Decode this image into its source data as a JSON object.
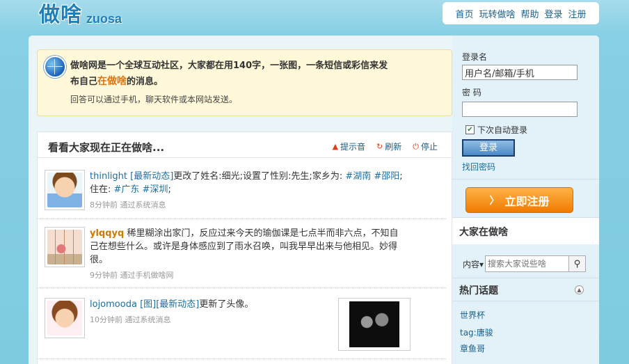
{
  "header": {
    "logo_cn": "做啥",
    "logo_en": "zuosa",
    "nav": [
      "首页",
      "玩转做啥",
      "帮助",
      "登录",
      "注册"
    ]
  },
  "notice": {
    "line_main_1": "做啥网是一个全球互动社区，大家都在用140字，一张图，一条短信或彩信来发",
    "line_main_2_a": "布自己",
    "line_main_2_hl": "在做啥",
    "line_main_2_b": "的消息。",
    "line_sub": "回答可以通过手机，聊天软件或本网站发送。"
  },
  "feed": {
    "title": "看看大家现在正在做啥...",
    "tools": [
      "提示音",
      "刷新",
      "停止"
    ],
    "items": [
      {
        "user": "thinlight",
        "tag": "[最新动态]",
        "text": "更改了姓名:细光;设置了性别:先生;家乡为: ",
        "topics": [
          "#湖南",
          "#邵阳",
          "#广东",
          "#深圳"
        ],
        "text_mid": ";住在: ",
        "text_end": ";",
        "meta": "8分钟前 通过系统消息"
      },
      {
        "user": "ylqqyq",
        "text": "稀里糊涂出家门，反应过来今天的瑜伽课是七点半而非六点，不知自己在想些什么。或许是身体感应到了雨水召唤，叫我早早出来与他相见。妙得很。",
        "meta": "9分钟前 通过手机做啥网"
      },
      {
        "user": "lojomooda",
        "tag1": "[图]",
        "tag2": "[最新动态]",
        "text": "更新了头像。",
        "meta": "10分钟前 通过系统消息"
      }
    ]
  },
  "login": {
    "username_label": "登录名",
    "username_value": "用户名/邮箱/手机",
    "password_label": "密  码",
    "password_value": "",
    "remember_label": "下次自动登录",
    "login_button": "登录",
    "forgot_link": "找回密码",
    "register_button": "立即注册"
  },
  "right": {
    "section_title": "大家在做啥",
    "search_scope": "内容▾",
    "search_placeholder": "搜索大家说些啥",
    "hot_title": "热门话题",
    "hot_items": [
      "世界杯",
      "tag:唐骏",
      "章鱼哥"
    ]
  },
  "colors": {
    "accent": "#1a6fa0",
    "highlight": "#e0730f",
    "register": "#f07a00"
  }
}
